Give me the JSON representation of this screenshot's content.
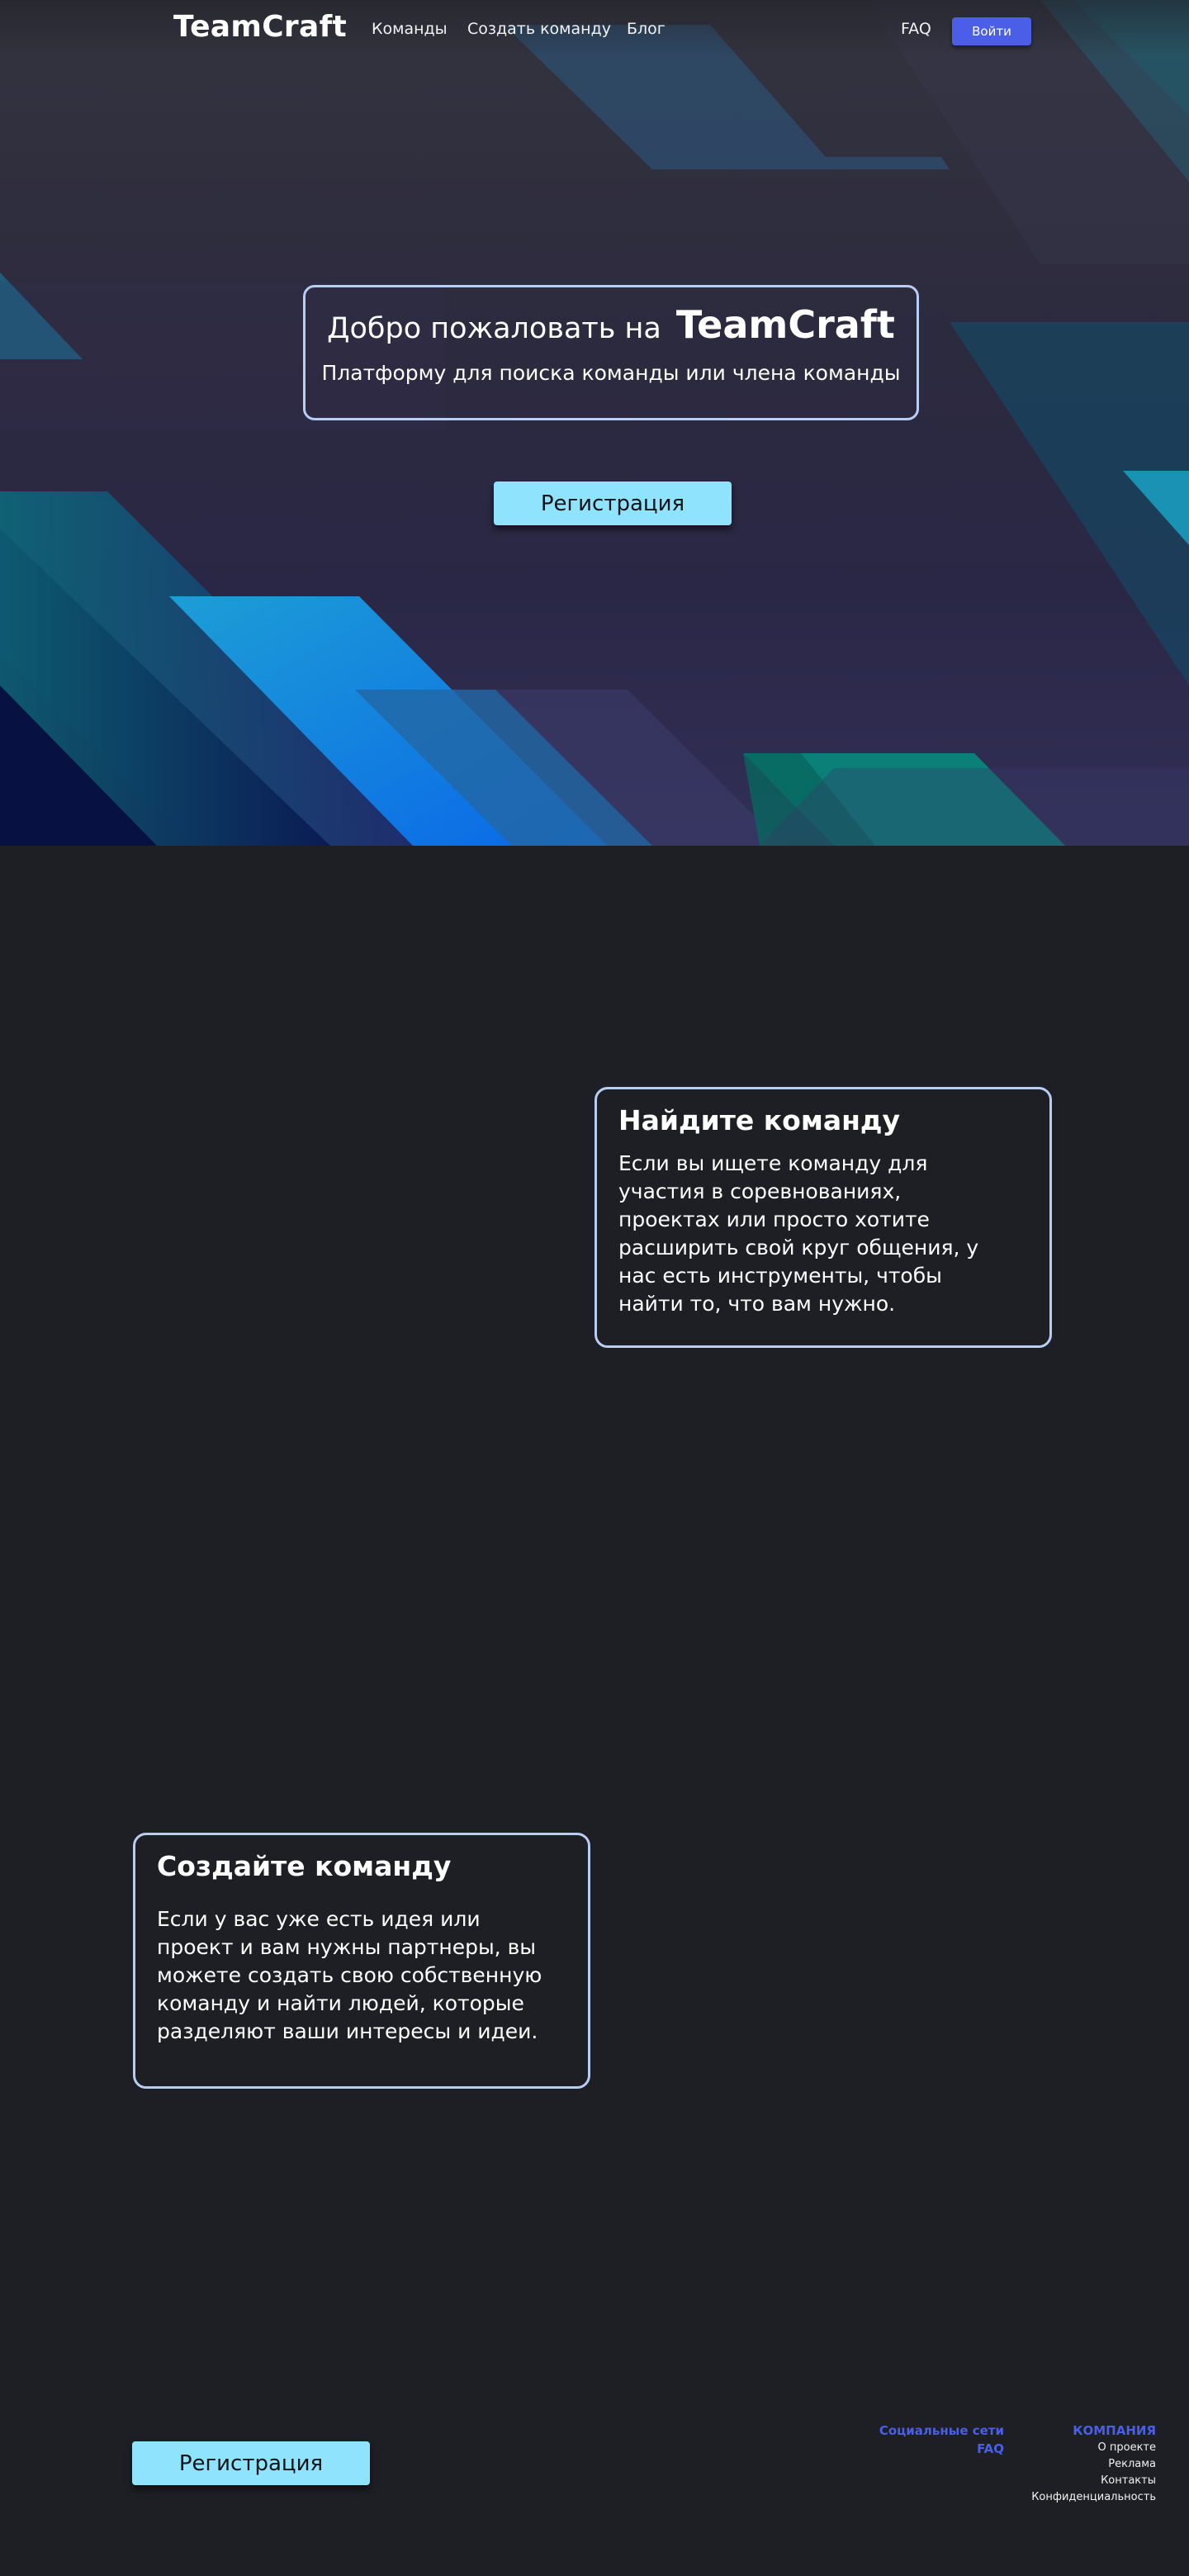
{
  "header": {
    "logo": "TeamCraft",
    "nav": {
      "teams": "Команды",
      "create_team": "Создать команду",
      "blog": "Блог",
      "faq": "FAQ"
    },
    "login_label": "Войти"
  },
  "hero": {
    "welcome_prefix": "Добро пожаловать на",
    "welcome_brand": "TeamCraft",
    "subtitle": "Платформу для поиска команды или члена команды",
    "register_label": "Регистрация"
  },
  "features": [
    {
      "title": "Найдите команду",
      "text": "Если вы ищете команду для участия в соревнованиях, проектах или просто хотите расширить свой круг общения, у нас есть инструменты, чтобы найти то, что вам нужно."
    },
    {
      "title": "Создайте команду",
      "text": "Если у вас уже есть идея или проект и вам нужны партнеры, вы можете создать свою собственную команду и найти людей, которые разделяют ваши интересы и идеи."
    }
  ],
  "footer": {
    "register_label": "Регистрация",
    "social_label": "Социальные сети",
    "faq_label": "FAQ",
    "company_heading": "КОМПАНИЯ",
    "company_links": [
      "О проекте",
      "Реклама",
      "Контакты",
      "Конфиденциальность"
    ]
  },
  "colors": {
    "page_bg": "#1d1f24",
    "accent_blue": "#4a5ee8",
    "button_cyan": "#8fe3fc",
    "card_border": "#b8cdf3"
  }
}
